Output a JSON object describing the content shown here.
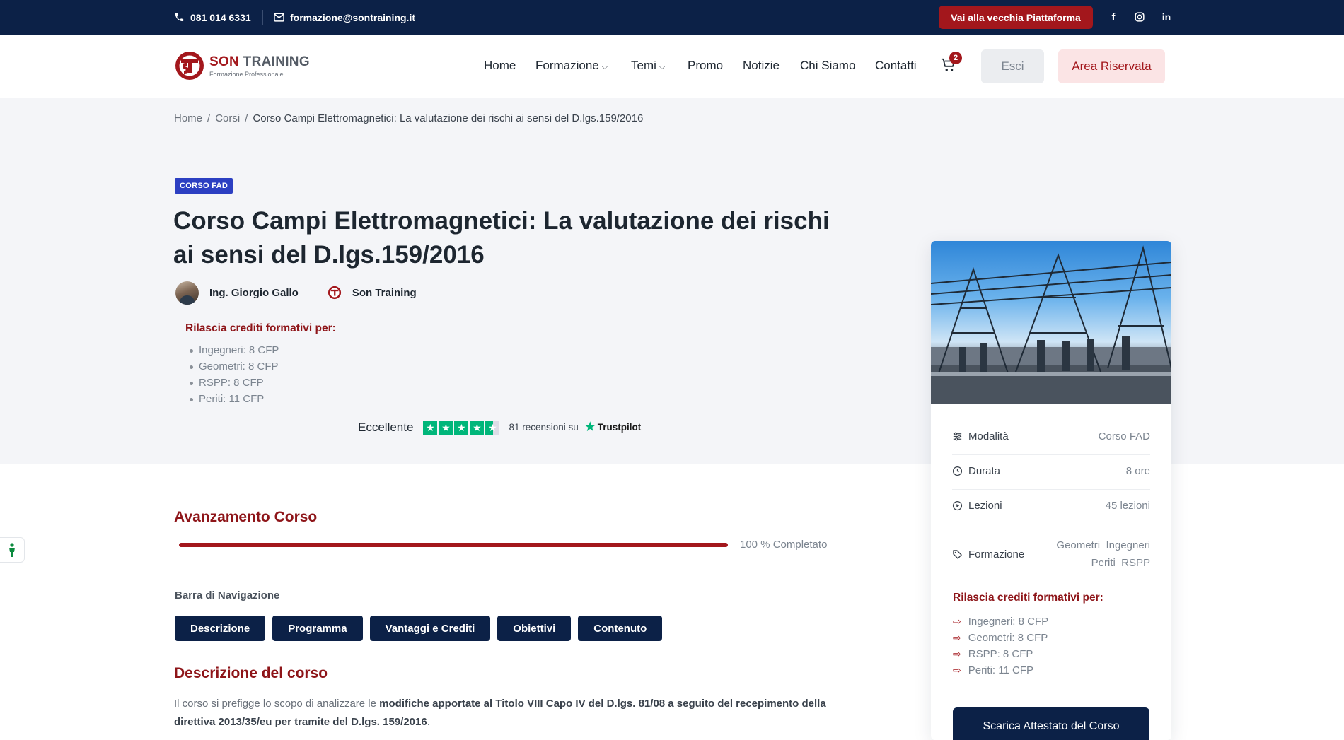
{
  "topbar": {
    "phone": "081 014 6331",
    "email": "formazione@sontraining.it",
    "old_platform_label": "Vai alla vecchia Piattaforma",
    "social": [
      "facebook-icon",
      "instagram-icon",
      "linkedin-icon"
    ]
  },
  "header": {
    "logo_title_a": "SON",
    "logo_title_b": "TRAINING",
    "logo_subtitle": "Formazione Professionale",
    "nav": {
      "home": "Home",
      "formazione": "Formazione",
      "temi": "Temi",
      "promo": "Promo",
      "notizie": "Notizie",
      "chi_siamo": "Chi Siamo",
      "contatti": "Contatti"
    },
    "cart_count": "2",
    "esci_label": "Esci",
    "area_label": "Area Riservata"
  },
  "breadcrumb": {
    "home": "Home",
    "corsi": "Corsi",
    "current": "Corso Campi Elettromagnetici: La valutazione dei rischi ai sensi del D.lgs.159/2016"
  },
  "course": {
    "badge": "CORSO FAD",
    "title": "Corso Campi Elettromagnetici: La valutazione dei rischi ai sensi del D.lgs.159/2016",
    "author": "Ing. Giorgio Gallo",
    "organization": "Son Training",
    "credits_title": "Rilascia crediti formativi per:",
    "credits": [
      "Ingegneri: 8 CFP",
      "Geometri: 8 CFP",
      "RSPP: 8 CFP",
      "Periti: 11 CFP"
    ]
  },
  "trustpilot": {
    "rating_word": "Eccellente",
    "reviews": "81 recensioni su",
    "brand": "Trustpilot",
    "stars": 4.5
  },
  "progress": {
    "title": "Avanzamento Corso",
    "percent": 100,
    "label": "100 % Completato"
  },
  "navigation": {
    "label": "Barra di Navigazione",
    "tabs": [
      "Descrizione",
      "Programma",
      "Vantaggi e Crediti",
      "Obiettivi",
      "Contenuto"
    ]
  },
  "description": {
    "title": "Descrizione del corso",
    "text_a": "Il corso si prefigge lo scopo di analizzare le ",
    "text_b": "modifiche apportate al Titolo VIII Capo IV del D.lgs. 81/08 a seguito del recepimento della direttiva 2013/35/eu per tramite del D.lgs. 159/2016",
    "text_c": "."
  },
  "card": {
    "modalita_label": "Modalità",
    "modalita_value": "Corso FAD",
    "durata_label": "Durata",
    "durata_value": "8 ore",
    "lezioni_label": "Lezioni",
    "lezioni_value": "45 lezioni",
    "formazione_label": "Formazione",
    "formazione_line1": "Geometri  Ingegneri",
    "formazione_line2": "Periti  RSPP",
    "credits_title": "Rilascia crediti formativi per:",
    "credits": [
      "Ingegneri: 8 CFP",
      "Geometri: 8 CFP",
      "RSPP: 8 CFP",
      "Periti: 11 CFP"
    ],
    "download_label": "Scarica Attestato del Corso"
  },
  "colors": {
    "navy": "#0c2147",
    "brand_red": "#a3171c",
    "dark_red": "#8e1519",
    "fad_blue": "#2c3fc2",
    "trustpilot_green": "#00b67a"
  }
}
